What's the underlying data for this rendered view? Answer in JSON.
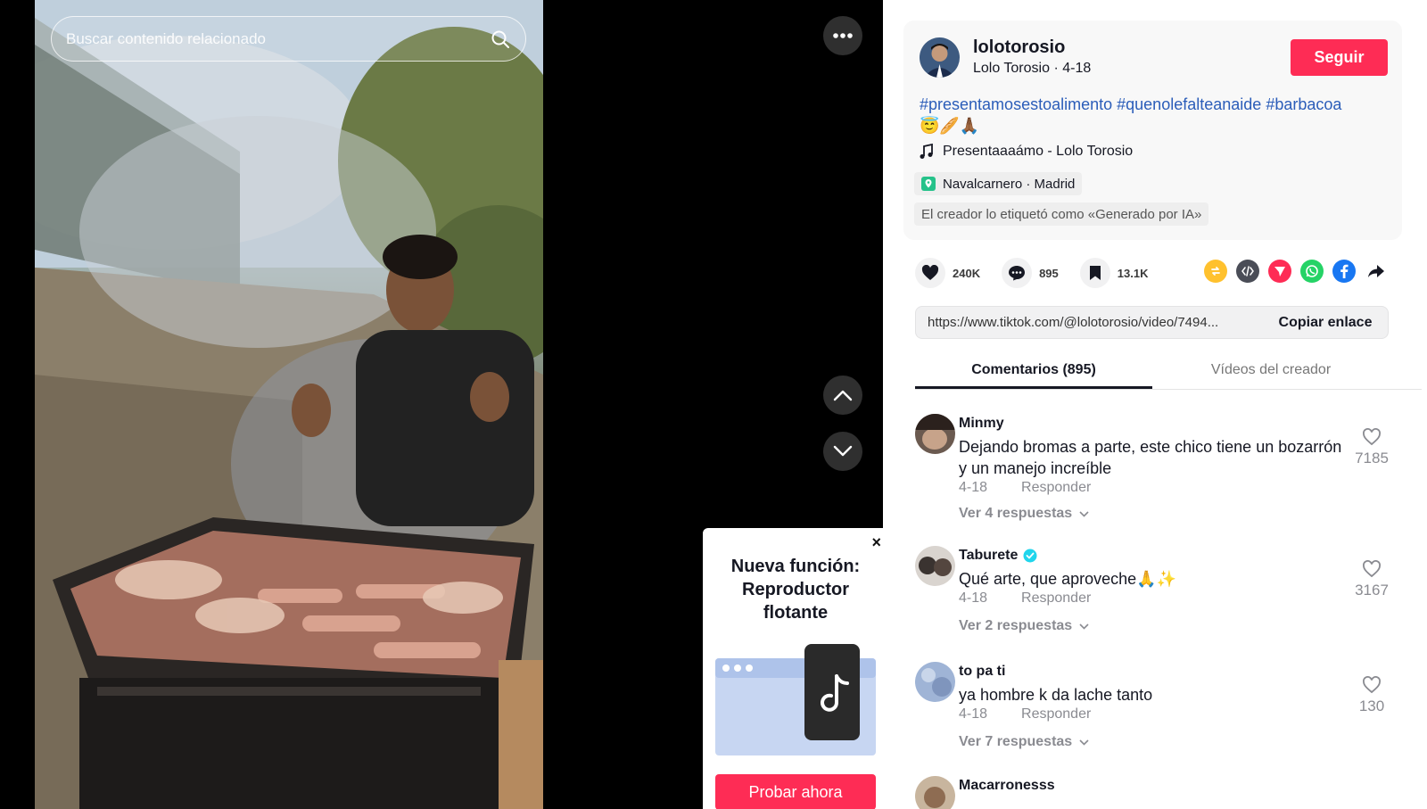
{
  "search": {
    "placeholder": "Buscar contenido relacionado"
  },
  "promo": {
    "title": "Nueva función: Reproductor flotante",
    "button": "Probar ahora",
    "close": "×"
  },
  "creator": {
    "username": "lolotorosio",
    "display_name": "Lolo Torosio",
    "date": "4-18",
    "follow_label": "Seguir",
    "description": {
      "hashtags": [
        "#presentamosestoalimento",
        "#quenolefalteanaide",
        "#barbacoa"
      ],
      "emojis": "😇🥖🙏🏾"
    },
    "music": "Presentaaaámo - Lolo Torosio",
    "location": "Navalcarnero · Madrid",
    "ai_label": "El creador lo etiquetó como «Generado por IA»"
  },
  "stats": {
    "likes": "240K",
    "comments": "895",
    "saves": "13.1K"
  },
  "share_icons": [
    "repost-icon",
    "embed-icon",
    "send-icon",
    "whatsapp-icon",
    "facebook-icon",
    "share-arrow-icon"
  ],
  "link": {
    "url": "https://www.tiktok.com/@lolotorosio/video/7494...",
    "copy_label": "Copiar enlace"
  },
  "tabs": [
    "Comentarios (895)",
    "Vídeos del creador"
  ],
  "comments": [
    {
      "name": "Minmy",
      "text": "Dejando bromas a parte, este chico tiene un bozarrón y un manejo increíble",
      "date": "4-18",
      "reply": "Responder",
      "replies": "Ver 4 respuestas",
      "likes": "7185",
      "verified": false
    },
    {
      "name": "Taburete",
      "text": "Qué arte, que aproveche🙏✨",
      "date": "4-18",
      "reply": "Responder",
      "replies": "Ver 2 respuestas",
      "likes": "3167",
      "verified": true
    },
    {
      "name": "to pa ti",
      "text": "ya hombre k da lache tanto",
      "date": "4-18",
      "reply": "Responder",
      "replies": "Ver 7 respuestas",
      "likes": "130",
      "verified": false
    },
    {
      "name": "Macarronesss",
      "text": "",
      "date": "",
      "reply": "",
      "replies": "",
      "likes": "",
      "verified": false
    }
  ],
  "colors": {
    "accent": "#fe2c55",
    "hashtag": "#2b5db9",
    "muted": "#8a8b91"
  }
}
